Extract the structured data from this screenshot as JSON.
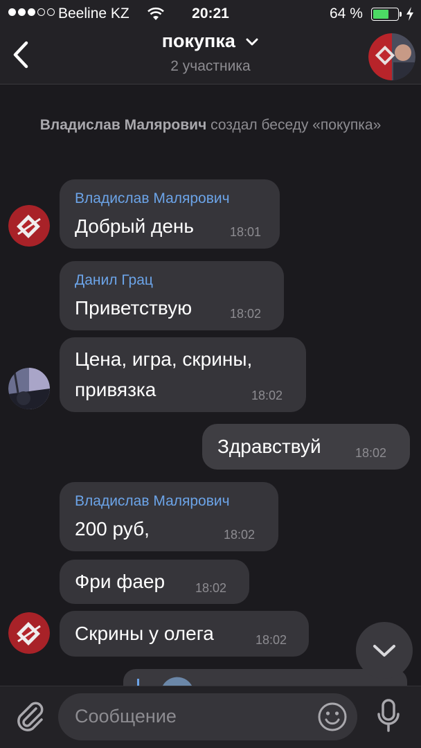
{
  "status": {
    "carrier": "Beeline KZ",
    "time": "20:21",
    "battery": "64 %",
    "battery_level": 0.64
  },
  "header": {
    "title": "покупка",
    "subtitle": "2 участника"
  },
  "system_message": {
    "author": "Владислав Малярович",
    "text": "создал беседу «покупка»"
  },
  "messages": [
    {
      "sender": "Владислав Малярович",
      "text": "Добрый день",
      "time": "18:01"
    },
    {
      "sender": "Данил Грац",
      "text": "Приветствую",
      "time": "18:02"
    },
    {
      "line1": "Цена, игра, скрины,",
      "line2": "привязка",
      "time": "18:02"
    },
    {
      "text": "Здравствуй",
      "time": "18:02"
    },
    {
      "sender": "Владислав Малярович",
      "text": "200 руб,",
      "time": "18:02"
    },
    {
      "text": "Фри фаер",
      "time": "18:02"
    },
    {
      "text": "Скрины у олега",
      "time": "18:02"
    }
  ],
  "input": {
    "placeholder": "Сообщение"
  },
  "colors": {
    "background": "#1b1a1e",
    "bubble": "#36353a",
    "sender_name": "#6ca4e8",
    "battery": "#4cd964"
  }
}
